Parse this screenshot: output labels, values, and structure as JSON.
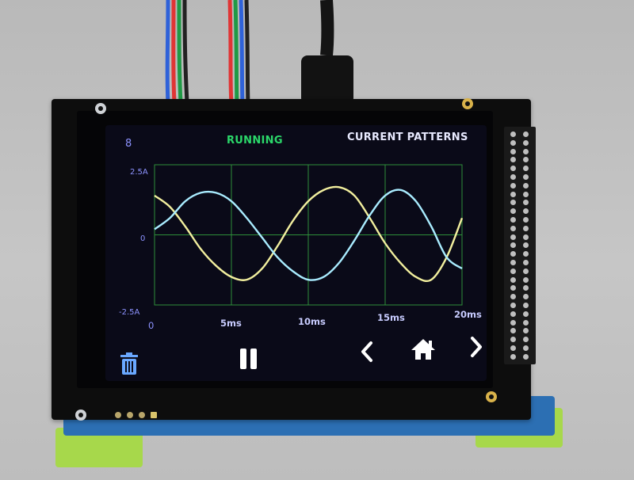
{
  "screen": {
    "corner_number": "8",
    "status": "RUNNING",
    "mode_title": "CURRENT PATTERNS",
    "colors": {
      "status": "#2bd86a",
      "title": "#e8eaff",
      "axis_text": "#8d93ff",
      "grid": "#2e8f3a",
      "series_a": "#f2ef9e",
      "series_b": "#a9ecff"
    }
  },
  "chart_data": {
    "type": "line",
    "x_unit": "ms",
    "y_unit": "A",
    "x_ticks": [
      "0",
      "5ms",
      "10ms",
      "15ms",
      "20ms"
    ],
    "y_ticks": [
      "2.5A",
      "0",
      "-2.5A"
    ],
    "xlim": [
      0,
      20
    ],
    "ylim": [
      -2.5,
      2.5
    ],
    "grid": true,
    "series": [
      {
        "color": "#f2ef9e",
        "x": [
          0,
          1,
          2,
          3,
          4,
          5,
          6,
          7,
          8,
          9,
          10,
          11,
          12,
          13,
          14,
          15,
          16,
          17,
          18,
          19,
          20
        ],
        "y": [
          1.4,
          1.0,
          0.3,
          -0.5,
          -1.1,
          -1.5,
          -1.6,
          -1.2,
          -0.4,
          0.5,
          1.2,
          1.6,
          1.7,
          1.4,
          0.6,
          -0.3,
          -1.0,
          -1.5,
          -1.6,
          -0.8,
          0.6
        ]
      },
      {
        "color": "#a9ecff",
        "x": [
          0,
          1,
          2,
          3,
          4,
          5,
          6,
          7,
          8,
          9,
          10,
          11,
          12,
          13,
          14,
          15,
          16,
          17,
          18,
          19,
          20
        ],
        "y": [
          0.2,
          0.6,
          1.2,
          1.5,
          1.5,
          1.2,
          0.6,
          -0.1,
          -0.8,
          -1.3,
          -1.6,
          -1.5,
          -1.0,
          -0.2,
          0.7,
          1.4,
          1.6,
          1.2,
          0.3,
          -0.8,
          -1.2
        ]
      }
    ]
  },
  "toolbar": {
    "delete": "trash-icon",
    "pause": "pause-icon",
    "previous": "chevron-left-icon",
    "home": "home-icon",
    "next": "chevron-right-icon",
    "icon_color": "#ffffff",
    "delete_color": "#6aa8ff"
  }
}
